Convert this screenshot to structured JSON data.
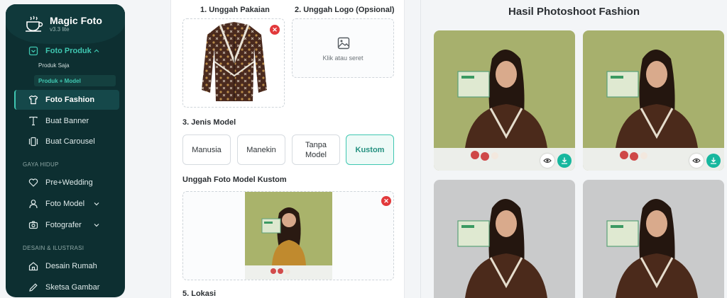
{
  "brand": {
    "title": "Magic Foto",
    "version": "v3.3 lite"
  },
  "sidebar": {
    "group_photo": {
      "label": "Foto Produk",
      "sub_items": [
        "Produk Saja",
        "Produk + Model"
      ]
    },
    "items_top": [
      {
        "label": "Foto Fashion"
      },
      {
        "label": "Buat Banner"
      },
      {
        "label": "Buat Carousel"
      }
    ],
    "section_lifestyle": "GAYA HIDUP",
    "items_lifestyle": [
      {
        "label": "Pre+Wedding"
      },
      {
        "label": "Foto Model"
      },
      {
        "label": "Fotografer"
      }
    ],
    "section_design": "DESAIN & ILUSTRASI",
    "items_design": [
      {
        "label": "Desain Rumah"
      },
      {
        "label": "Sketsa Gambar"
      }
    ]
  },
  "form": {
    "step1_label": "1. Unggah Pakaian",
    "step2_label": "2. Unggah Logo (Opsional)",
    "logo_hint": "Klik atau seret",
    "step3_label": "3. Jenis Model",
    "model_types": [
      "Manusia",
      "Manekin",
      "Tanpa Model",
      "Kustom"
    ],
    "custom_model_label": "Unggah Foto Model Kustom",
    "step5_label": "5. Lokasi"
  },
  "results": {
    "title": "Hasil Photoshoot Fashion"
  },
  "colors": {
    "sidebar_bg": "#0d2f31",
    "accent": "#3fc7b1",
    "danger": "#e2393b",
    "download": "#17b79e"
  }
}
